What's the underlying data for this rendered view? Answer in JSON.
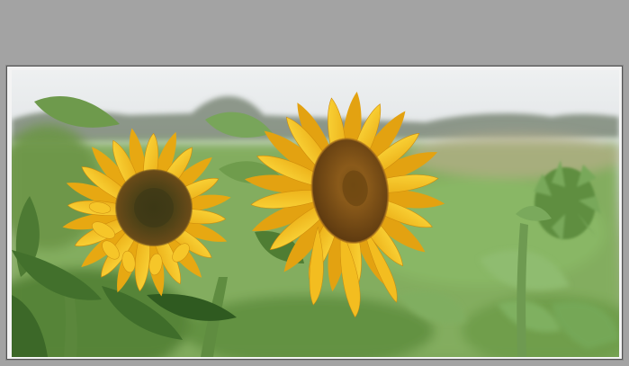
{
  "photo": {
    "subject": "sunflower-photograph",
    "colors": {
      "page_background": "#a3a3a3",
      "frame": "#f4f4f4",
      "sky": "#e8eaeb",
      "petal": "#f4c31b",
      "petal_shadow": "#d99a0f",
      "disc": "#6b4a16",
      "leaf": "#5b8d3a",
      "field": "#7dab57"
    }
  }
}
